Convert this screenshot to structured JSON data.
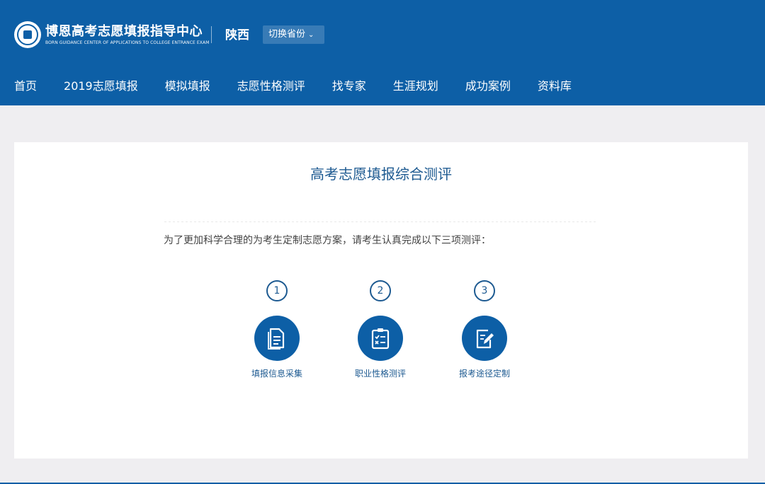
{
  "header": {
    "brand_cn": "博恩高考志愿填报指导中心",
    "brand_en": "BORN GUIDANCE CENTER OF APPLICATIONS TO COLLEGE ENTRANCE EXAM",
    "province": "陕西",
    "switch_label": "切换省份",
    "accent_color": "#0d5fa6"
  },
  "nav": {
    "items": [
      {
        "label": "首页"
      },
      {
        "label": "2019志愿填报"
      },
      {
        "label": "模拟填报"
      },
      {
        "label": "志愿性格测评"
      },
      {
        "label": "找专家"
      },
      {
        "label": "生涯规划"
      },
      {
        "label": "成功案例"
      },
      {
        "label": "资料库"
      }
    ]
  },
  "main": {
    "title": "高考志愿填报综合测评",
    "instruction": "为了更加科学合理的为考生定制志愿方案，请考生认真完成以下三项测评：",
    "steps": [
      {
        "number": "1",
        "label": "填报信息采集",
        "icon": "document-icon"
      },
      {
        "number": "2",
        "label": "职业性格测评",
        "icon": "clipboard-checklist-icon"
      },
      {
        "number": "3",
        "label": "报考途径定制",
        "icon": "edit-note-icon"
      }
    ]
  }
}
